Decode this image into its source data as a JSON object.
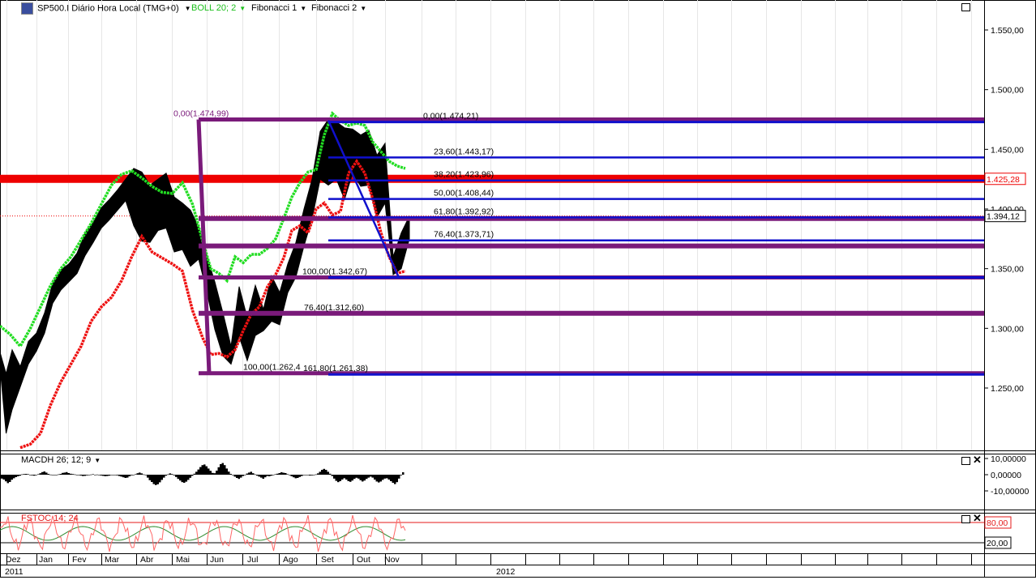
{
  "header": {
    "symbol_label": "SP500.I Diário Hora Local (TMG+0)",
    "indicator_boll": "BOLL 20; 2",
    "indicator_fib1": "Fibonacci 1",
    "indicator_fib2": "Fibonacci 2"
  },
  "colors": {
    "price": "#000000",
    "boll_upper": "#22dd22",
    "boll_lower": "#ee1111",
    "fib1": "#7a1a7a",
    "fib2": "#1010cc",
    "stoch_k": "#ff6666",
    "stoch_d": "#2e8b2e",
    "resistance": "#ee0000"
  },
  "chart_data": [
    {
      "type": "line",
      "name": "main-price-chart",
      "ylim": [
        1200,
        1580
      ],
      "y_ticks": [
        "1.550,00",
        "1.500,00",
        "1.450,00",
        "1.400,00",
        "1.350,00",
        "1.300,00",
        "1.250,00"
      ],
      "y_tick_values": [
        1550,
        1500,
        1450,
        1400,
        1350,
        1300,
        1250
      ],
      "x_months": [
        "Dez",
        "Jan",
        "Fev",
        "Mar",
        "Abr",
        "Mai",
        "Jun",
        "Jul",
        "Ago",
        "Set",
        "Out",
        "Nov"
      ],
      "x_years": [
        "2011",
        "2012"
      ],
      "price_tags": [
        {
          "label": "1.425,28",
          "value": 1425.28,
          "style": "red"
        },
        {
          "label": "1.394,12",
          "value": 1394.12,
          "style": "black"
        }
      ],
      "series": [
        {
          "key": "price_high",
          "points": [
            [
              0,
              1280
            ],
            [
              3,
              1262
            ],
            [
              6,
              1282
            ],
            [
              10,
              1268
            ],
            [
              14,
              1289
            ],
            [
              18,
              1296
            ],
            [
              22,
              1313
            ],
            [
              26,
              1338
            ],
            [
              30,
              1349
            ],
            [
              34,
              1354
            ],
            [
              38,
              1363
            ],
            [
              42,
              1380
            ],
            [
              46,
              1389
            ],
            [
              50,
              1401
            ],
            [
              54,
              1408
            ],
            [
              58,
              1416
            ],
            [
              62,
              1425
            ],
            [
              66,
              1434
            ],
            [
              70,
              1431
            ],
            [
              74,
              1420
            ],
            [
              78,
              1425
            ],
            [
              82,
              1430
            ],
            [
              86,
              1410
            ],
            [
              90,
              1405
            ],
            [
              94,
              1399
            ],
            [
              98,
              1385
            ],
            [
              102,
              1361
            ],
            [
              106,
              1339
            ],
            [
              110,
              1313
            ],
            [
              114,
              1285
            ],
            [
              118,
              1335
            ],
            [
              122,
              1309
            ],
            [
              126,
              1336
            ],
            [
              130,
              1316
            ],
            [
              134,
              1344
            ],
            [
              138,
              1330
            ],
            [
              142,
              1354
            ],
            [
              146,
              1372
            ],
            [
              150,
              1400
            ],
            [
              154,
              1425
            ],
            [
              158,
              1465
            ],
            [
              162,
              1475
            ],
            [
              166,
              1473
            ],
            [
              170,
              1468
            ],
            [
              174,
              1467
            ],
            [
              178,
              1462
            ],
            [
              182,
              1466
            ],
            [
              186,
              1445
            ],
            [
              190,
              1455
            ],
            [
              194,
              1360
            ],
            [
              198,
              1380
            ],
            [
              202,
              1394
            ]
          ]
        },
        {
          "key": "price_low",
          "points": [
            [
              0,
              1268
            ],
            [
              3,
              1212
            ],
            [
              6,
              1232
            ],
            [
              10,
              1251
            ],
            [
              14,
              1270
            ],
            [
              18,
              1281
            ],
            [
              22,
              1296
            ],
            [
              26,
              1321
            ],
            [
              30,
              1332
            ],
            [
              34,
              1339
            ],
            [
              38,
              1346
            ],
            [
              42,
              1361
            ],
            [
              46,
              1372
            ],
            [
              50,
              1384
            ],
            [
              54,
              1391
            ],
            [
              58,
              1399
            ],
            [
              62,
              1407
            ],
            [
              66,
              1386
            ],
            [
              70,
              1373
            ],
            [
              74,
              1372
            ],
            [
              78,
              1382
            ],
            [
              82,
              1384
            ],
            [
              86,
              1364
            ],
            [
              90,
              1366
            ],
            [
              94,
              1352
            ],
            [
              98,
              1358
            ],
            [
              102,
              1331
            ],
            [
              106,
              1299
            ],
            [
              110,
              1277
            ],
            [
              114,
              1270
            ],
            [
              118,
              1293
            ],
            [
              122,
              1273
            ],
            [
              126,
              1294
            ],
            [
              130,
              1298
            ],
            [
              134,
              1306
            ],
            [
              138,
              1303
            ],
            [
              142,
              1330
            ],
            [
              146,
              1343
            ],
            [
              150,
              1369
            ],
            [
              154,
              1392
            ],
            [
              158,
              1425
            ],
            [
              162,
              1420
            ],
            [
              166,
              1425
            ],
            [
              170,
              1408
            ],
            [
              174,
              1430
            ],
            [
              178,
              1419
            ],
            [
              182,
              1420
            ],
            [
              186,
              1393
            ],
            [
              190,
              1405
            ],
            [
              194,
              1345
            ],
            [
              198,
              1350
            ],
            [
              202,
              1375
            ]
          ]
        },
        {
          "key": "boll_upper",
          "points": [
            [
              0,
              1302
            ],
            [
              5,
              1295
            ],
            [
              10,
              1285
            ],
            [
              15,
              1300
            ],
            [
              20,
              1318
            ],
            [
              25,
              1336
            ],
            [
              30,
              1350
            ],
            [
              35,
              1360
            ],
            [
              40,
              1374
            ],
            [
              45,
              1388
            ],
            [
              50,
              1404
            ],
            [
              55,
              1420
            ],
            [
              60,
              1429
            ],
            [
              65,
              1432
            ],
            [
              70,
              1426
            ],
            [
              75,
              1419
            ],
            [
              80,
              1414
            ],
            [
              85,
              1413
            ],
            [
              90,
              1422
            ],
            [
              95,
              1404
            ],
            [
              100,
              1373
            ],
            [
              104,
              1350
            ],
            [
              108,
              1346
            ],
            [
              112,
              1340
            ],
            [
              116,
              1360
            ],
            [
              120,
              1355
            ],
            [
              124,
              1362
            ],
            [
              128,
              1362
            ],
            [
              132,
              1367
            ],
            [
              136,
              1375
            ],
            [
              140,
              1392
            ],
            [
              144,
              1410
            ],
            [
              148,
              1422
            ],
            [
              152,
              1431
            ],
            [
              156,
              1433
            ],
            [
              160,
              1462
            ],
            [
              164,
              1480
            ],
            [
              168,
              1474
            ],
            [
              172,
              1470
            ],
            [
              176,
              1472
            ],
            [
              180,
              1470
            ],
            [
              184,
              1456
            ],
            [
              188,
              1448
            ],
            [
              192,
              1440
            ],
            [
              196,
              1436
            ],
            [
              200,
              1434
            ]
          ]
        },
        {
          "key": "boll_lower",
          "points": [
            [
              10,
              1200
            ],
            [
              15,
              1203
            ],
            [
              20,
              1212
            ],
            [
              25,
              1236
            ],
            [
              30,
              1255
            ],
            [
              35,
              1270
            ],
            [
              40,
              1285
            ],
            [
              45,
              1306
            ],
            [
              50,
              1318
            ],
            [
              55,
              1326
            ],
            [
              60,
              1340
            ],
            [
              65,
              1360
            ],
            [
              70,
              1377
            ],
            [
              75,
              1364
            ],
            [
              80,
              1359
            ],
            [
              85,
              1354
            ],
            [
              90,
              1348
            ],
            [
              95,
              1315
            ],
            [
              100,
              1292
            ],
            [
              104,
              1278
            ],
            [
              108,
              1279
            ],
            [
              112,
              1276
            ],
            [
              116,
              1282
            ],
            [
              120,
              1298
            ],
            [
              124,
              1312
            ],
            [
              128,
              1318
            ],
            [
              132,
              1335
            ],
            [
              136,
              1345
            ],
            [
              140,
              1359
            ],
            [
              144,
              1382
            ],
            [
              148,
              1386
            ],
            [
              152,
              1380
            ],
            [
              156,
              1400
            ],
            [
              160,
              1405
            ],
            [
              164,
              1395
            ],
            [
              168,
              1398
            ],
            [
              172,
              1430
            ],
            [
              176,
              1440
            ],
            [
              180,
              1430
            ],
            [
              184,
              1408
            ],
            [
              188,
              1380
            ],
            [
              192,
              1360
            ],
            [
              196,
              1346
            ],
            [
              200,
              1348
            ]
          ]
        }
      ]
    },
    {
      "type": "line",
      "name": "fibonacci-levels",
      "fib1": {
        "levels": [
          {
            "label": "0,00(1.474,99)",
            "value": 1474.99
          },
          {
            "label": "",
            "value": 1392.0
          },
          {
            "label": "",
            "value": 1369.0
          },
          {
            "label": "100,00(1.342,67)",
            "value": 1342.67
          },
          {
            "label": "76,40(1.312,60)",
            "value": 1312.6
          },
          {
            "label": "100,00(1.262,4",
            "value": 1262.4
          }
        ]
      },
      "fib2": {
        "levels": [
          {
            "label": "0,00(1.474,21)",
            "value": 1474.21
          },
          {
            "label": "23,60(1.443,17)",
            "value": 1443.17
          },
          {
            "label": "38,20(1.423,96)",
            "value": 1423.96
          },
          {
            "label": "50,00(1.408,44)",
            "value": 1408.44
          },
          {
            "label": "61,80(1.392,92)",
            "value": 1392.92
          },
          {
            "label": "76,40(1.373,71)",
            "value": 1373.71
          },
          {
            "label": "100,00(1.342,67)",
            "value": 1342.67
          },
          {
            "label": "161,80(1.261,38)",
            "value": 1261.38
          }
        ]
      }
    },
    {
      "type": "bar",
      "name": "macd-histogram",
      "title": "MACDH 26; 12; 9",
      "y_ticks": [
        "10,00000",
        "0,00000",
        "-10,00000"
      ],
      "y_tick_values": [
        10,
        0,
        -10
      ],
      "ylim": [
        -15,
        15
      ],
      "values": [
        -2.4,
        -3.0,
        -4.1,
        -5.2,
        -4.5,
        -3.1,
        -2.2,
        -1.5,
        -1.0,
        -0.6,
        0.2,
        0.4,
        0.5,
        0.3,
        0.0,
        -0.4,
        -0.6,
        -0.3,
        0.3,
        0.9,
        1.6,
        2.0,
        1.3,
        0.5,
        0.1,
        0.0,
        -0.2,
        -0.1,
        0.2,
        0.5,
        1.1,
        1.3,
        1.6,
        1.0,
        0.6,
        0.4,
        0.2,
        0.0,
        -0.2,
        -0.5,
        -0.8,
        -0.7,
        -0.4,
        -0.1,
        0.1,
        0.3,
        0.0,
        0.1,
        -0.3,
        -0.5,
        -0.7,
        -0.9,
        -0.8,
        -0.6,
        -0.3,
        0.0,
        -0.2,
        -0.4,
        -0.8,
        -1.2,
        -1.6,
        -2.0,
        -1.8,
        -1.0,
        -0.4,
        0.0,
        0.3,
        0.9,
        1.3,
        0.8,
        0.2,
        -0.2,
        -1.8,
        -3.4,
        -4.5,
        -5.8,
        -6.4,
        -5.9,
        -4.7,
        -3.2,
        -1.8,
        -0.6,
        0.2,
        0.8,
        0.4,
        -0.4,
        -1.4,
        -2.6,
        -3.6,
        -4.6,
        -5.0,
        -4.3,
        -3.2,
        -1.9,
        -0.7,
        0.6,
        1.8,
        3.2,
        4.7,
        5.9,
        6.3,
        5.2,
        3.8,
        2.4,
        1.1,
        0.9,
        2.5,
        4.6,
        6.5,
        7.2,
        5.9,
        3.8,
        1.9,
        0.5,
        -0.3,
        -1.2,
        -2.0,
        -2.6,
        -1.8,
        -0.8,
        0.0,
        0.7,
        1.3,
        1.8,
        0.9,
        0.2,
        -0.6,
        -1.2,
        -1.8,
        -2.5,
        -1.6,
        -0.8,
        -1.0,
        -0.6,
        -0.2,
        0.3,
        0.6,
        1.0,
        1.5,
        1.2,
        1.0,
        0.3,
        -0.3,
        -1.0,
        -1.6,
        -2.2,
        -2.0,
        -1.4,
        -0.8,
        -0.2,
        0.0,
        -0.2,
        -0.5,
        -0.4,
        -0.1,
        0.2,
        0.8,
        1.8,
        3.0,
        3.6,
        3.0,
        1.8,
        0.6,
        -0.8,
        -2.4,
        -3.8,
        -4.6,
        -4.0,
        -3.0,
        -2.2,
        -3.0,
        -4.0,
        -4.4,
        -3.6,
        -2.6,
        -1.9,
        -2.4,
        -3.4,
        -4.2,
        -3.6,
        -2.6,
        -1.8,
        -1.2,
        -1.8,
        -3.0,
        -4.2,
        -4.8,
        -4.2,
        -3.2,
        -2.4,
        -2.2,
        -3.0,
        -4.0,
        -5.0,
        -5.8,
        -4.6,
        -2.4,
        -0.4,
        1.5
      ]
    },
    {
      "type": "line",
      "name": "fstoc",
      "title": "FSTOC 14; 24",
      "y_ticks": [
        "80,00",
        "20,00"
      ],
      "y_tick_values": [
        80,
        20
      ],
      "ylim": [
        0,
        100
      ]
    }
  ]
}
